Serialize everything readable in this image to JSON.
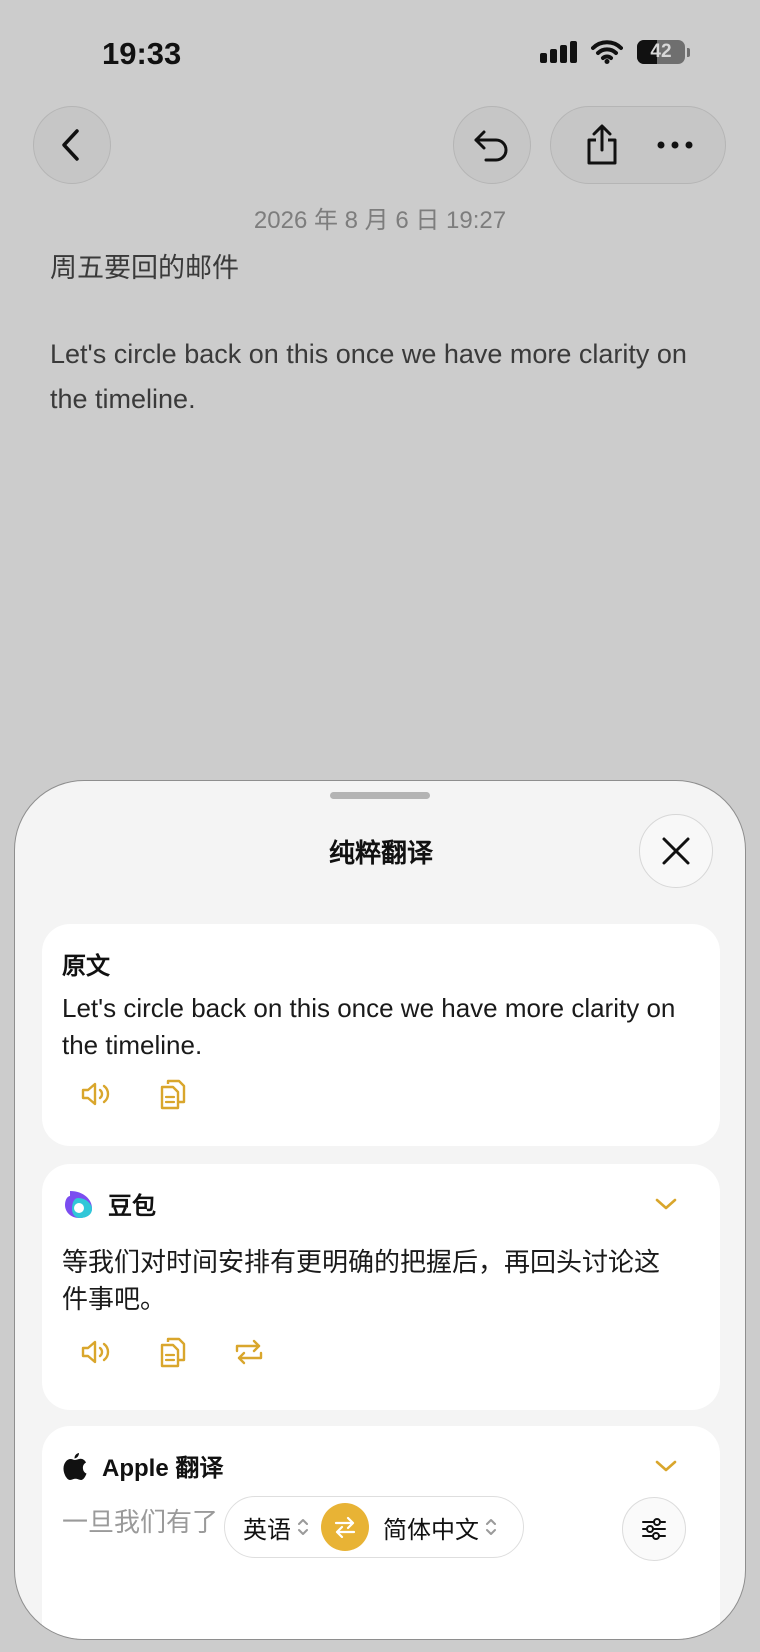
{
  "status_bar": {
    "time": "19:33",
    "battery": "42",
    "battery_level": 0.42
  },
  "note": {
    "date": "2026 年 8 月 6 日 19:27",
    "title": "周五要回的邮件",
    "body": "Let's circle back on this once we have more clarity on the timeline."
  },
  "sheet": {
    "title": "纯粹翻译",
    "original": {
      "label": "原文",
      "text": "Let's circle back on this once we have more clarity on the timeline."
    },
    "doubao": {
      "label": "豆包",
      "text": "等我们对时间安排有更明确的把握后，再回头讨论这件事吧。"
    },
    "apple": {
      "label": "Apple 翻译",
      "text": "一旦我们有了"
    },
    "lang_bar": {
      "source": "英语",
      "target": "简体中文"
    }
  },
  "colors": {
    "accent": "#e8b335",
    "icon_gold": "#d9a62c"
  }
}
